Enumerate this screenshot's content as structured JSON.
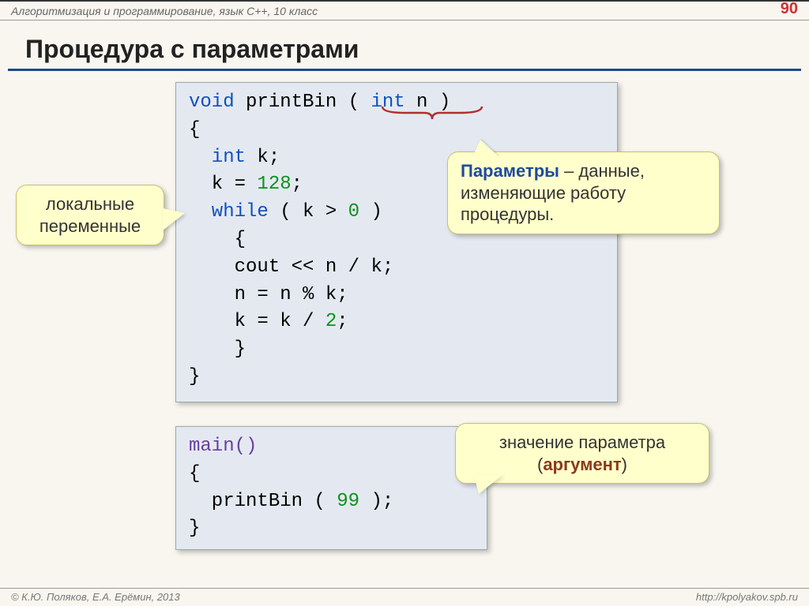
{
  "header": {
    "course": "Алгоритмизация и программирование, язык  C++, 10 класс",
    "page": "90"
  },
  "title": "Процедура с параметрами",
  "code": {
    "l1a": "void",
    "l1b": " printBin ( ",
    "l1c": "int",
    "l1d": " n )",
    "l2": "{",
    "l3a": "  int",
    "l3b": " k;",
    "l4a": "  k = ",
    "l4b": "128",
    "l4c": ";",
    "l5a": "  while",
    "l5b": " ( k > ",
    "l5c": "0",
    "l5d": " )",
    "l6": "    {",
    "l7": "    cout << n / k;",
    "l8": "    n = n % k;",
    "l9a": "    k = k / ",
    "l9b": "2",
    "l9c": ";",
    "l10": "    }",
    "l11": "}"
  },
  "code2": {
    "l1": "main()",
    "l2": "{",
    "l3a": "  printBin ( ",
    "l3b": "99",
    "l3c": " );",
    "l4": "}"
  },
  "callouts": {
    "local_vars": "локальные переменные",
    "params_title": "Параметры",
    "params_rest": " – данные, изменяющие работу процедуры.",
    "arg1": "значение параметра (",
    "arg_word": "аргумент",
    "arg2": ")"
  },
  "footer": {
    "left": "© К.Ю. Поляков, Е.А. Ерёмин, 2013",
    "right": "http://kpolyakov.spb.ru"
  }
}
